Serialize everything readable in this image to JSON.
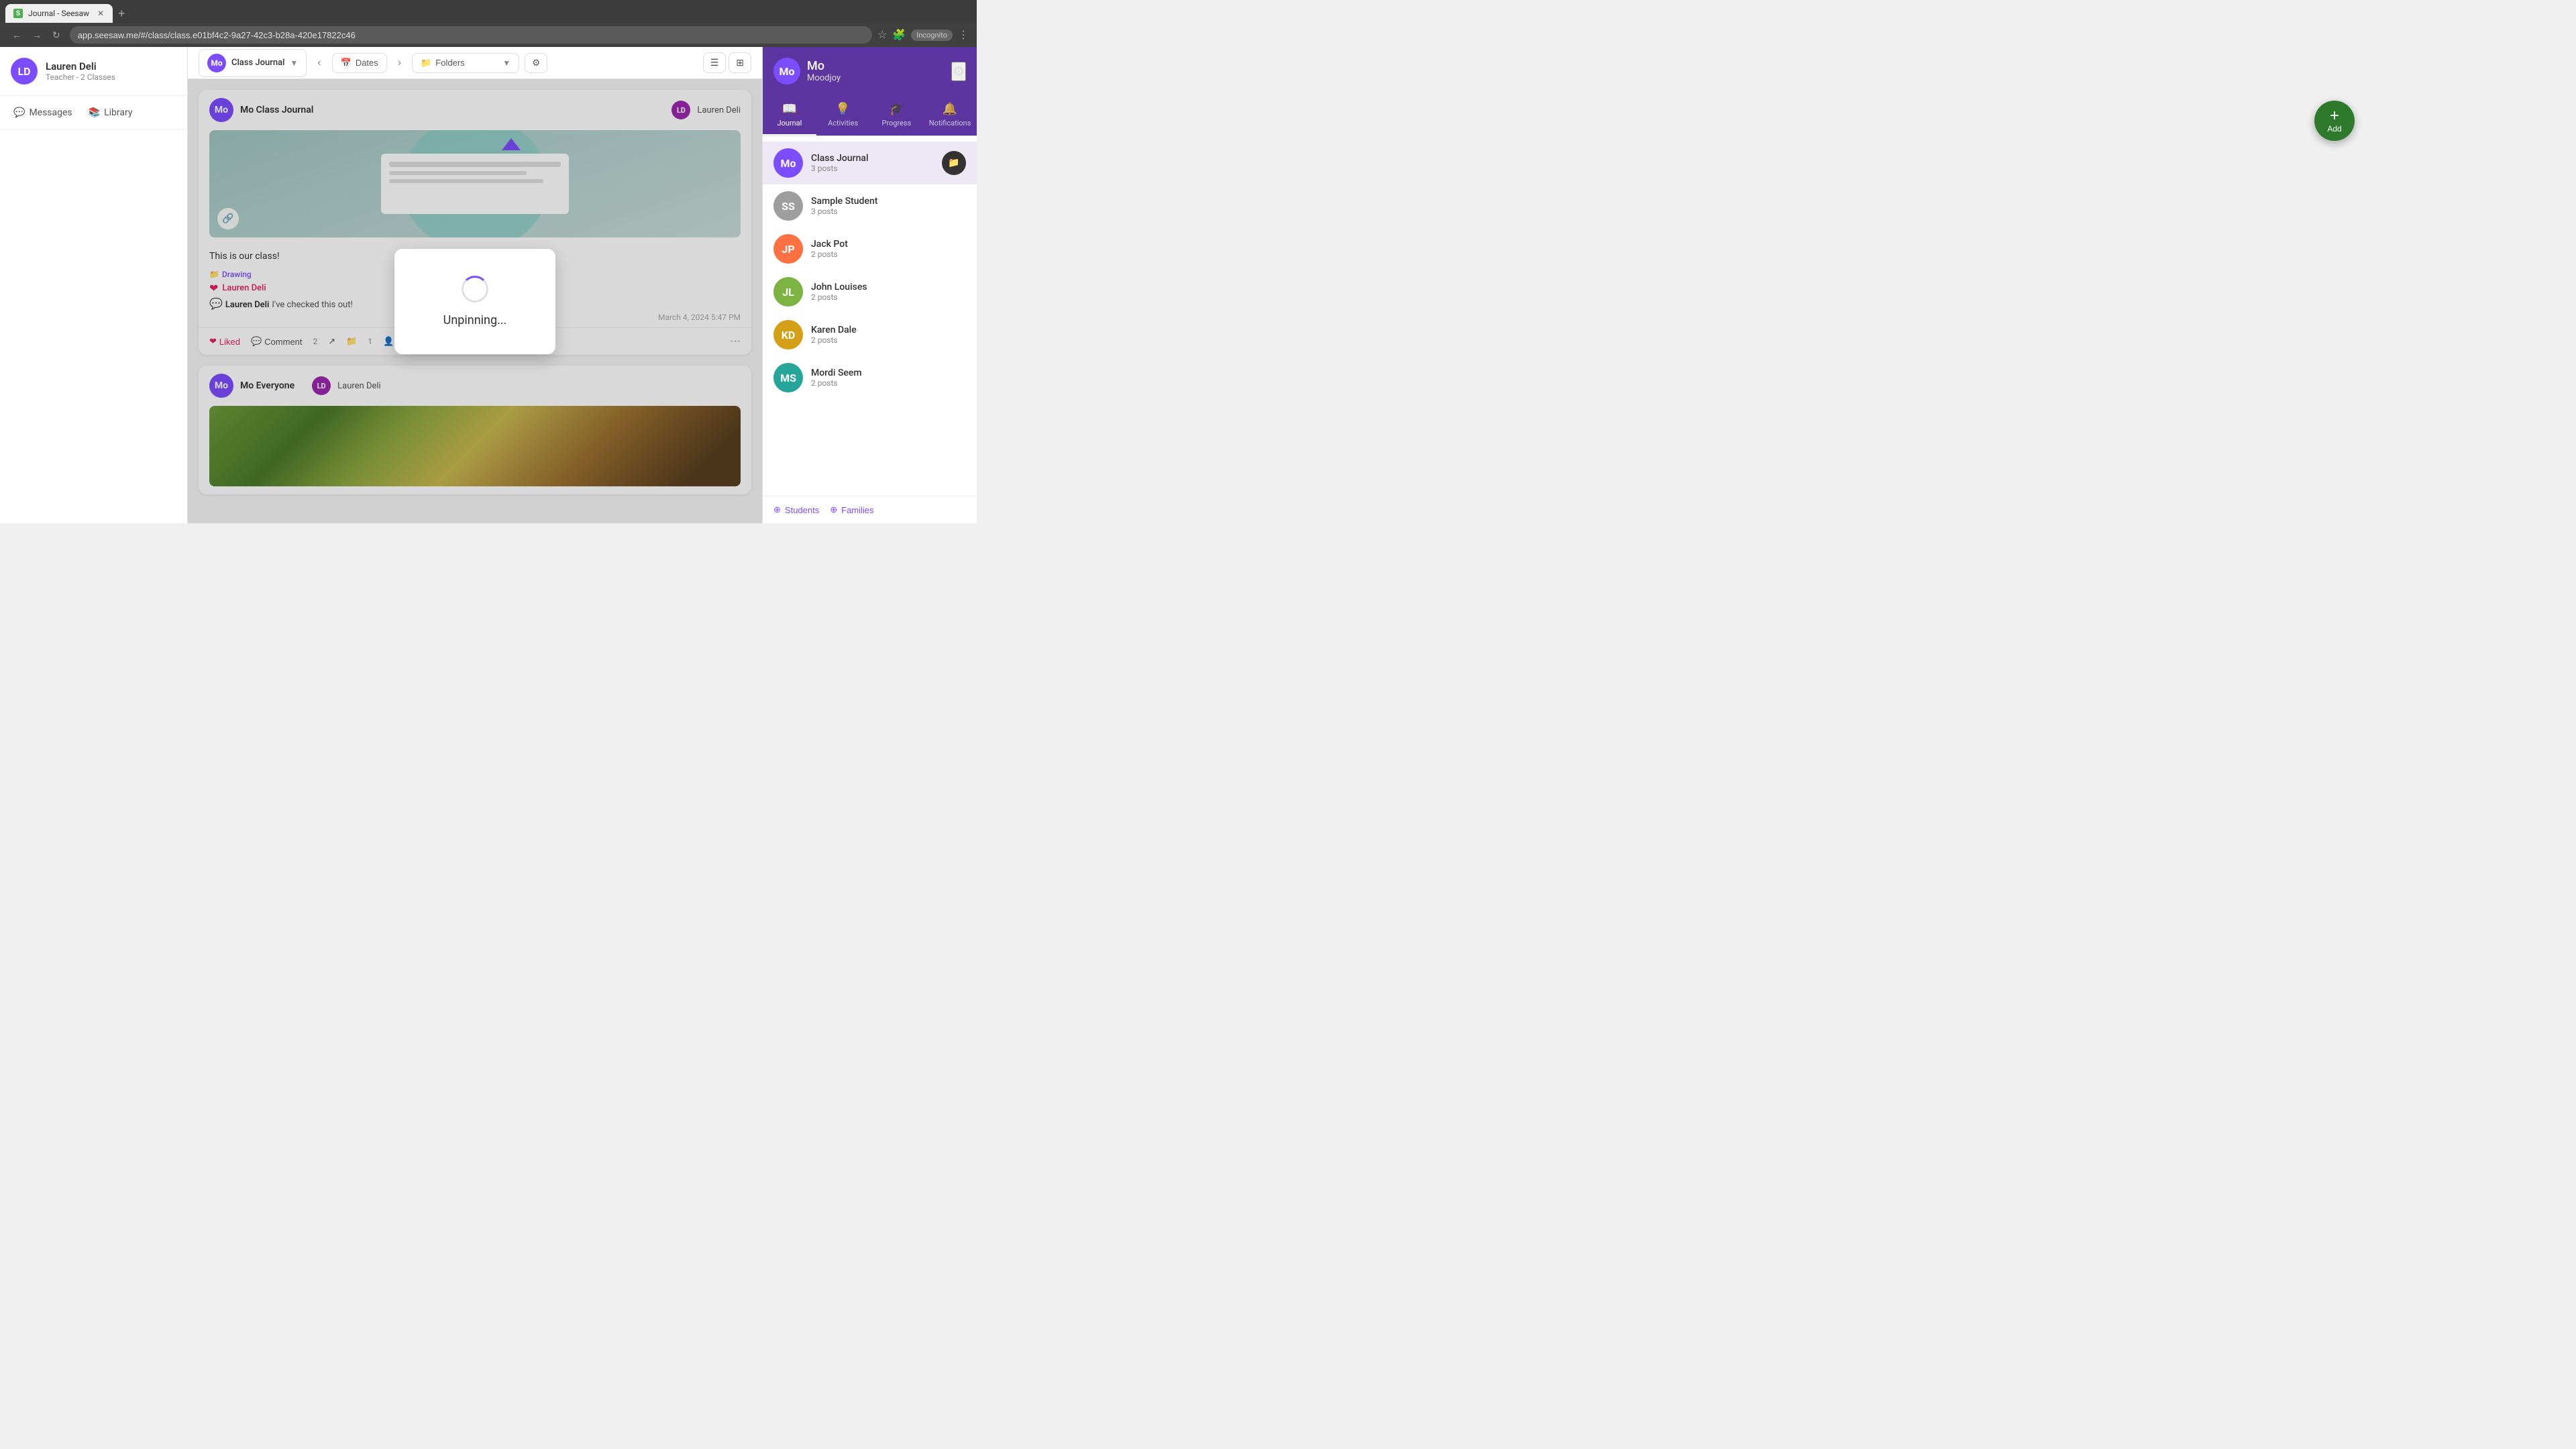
{
  "browser": {
    "tab_title": "Journal - Seesaw",
    "tab_favicon": "S",
    "url": "app.seesaw.me/#/class/class.e01bf4c2-9a27-42c3-b28a-420e17822c46",
    "incognito_label": "Incognito"
  },
  "user": {
    "name": "Lauren Deli",
    "role": "Teacher - 2 Classes",
    "avatar_initials": "LD"
  },
  "nav": {
    "messages_label": "Messages",
    "library_label": "Library"
  },
  "toolbar": {
    "journal_label": "Class Journal",
    "dates_label": "Dates",
    "folders_label": "Folders",
    "avatar_initials": "Mo"
  },
  "add_button": {
    "plus_label": "+",
    "label": "Add"
  },
  "post1": {
    "author": "Mo Class Journal",
    "author_initials": "Mo",
    "avatar_bg": "#7c4dff",
    "teacher_name": "Lauren Deli",
    "teacher_initials": "LD",
    "text": "This is our class!",
    "folder": "Drawing",
    "liked_label": "Lauren Deli",
    "comment_author": "Lauren Deli",
    "comment_text": "I've checked this out!",
    "timestamp": "March 4, 2024 5:47 PM",
    "action_liked": "Liked",
    "action_comment": "Comment",
    "action_comments_count": "2",
    "action_folders_count": "1"
  },
  "post2": {
    "author": "Mo Everyone",
    "author_initials": "Mo",
    "avatar_bg": "#7c4dff",
    "teacher_name": "Lauren Deli",
    "teacher_initials": "LD"
  },
  "unpinning": {
    "text": "Unpinning..."
  },
  "right_sidebar": {
    "user_name": "Mo",
    "username": "Moodjoy",
    "settings_icon": "⚙",
    "tabs": [
      {
        "id": "journal",
        "label": "Journal",
        "icon": "📖",
        "active": true
      },
      {
        "id": "activities",
        "label": "Activities",
        "icon": "💡",
        "active": false
      },
      {
        "id": "progress",
        "label": "Progress",
        "icon": "🎓",
        "active": false
      },
      {
        "id": "notifications",
        "label": "Notifications",
        "icon": "🔔",
        "active": false
      }
    ],
    "students": [
      {
        "name": "Class Journal",
        "initials": "Mo",
        "posts": "3 posts",
        "bg": "#7c4dff",
        "active": true,
        "has_folder": true
      },
      {
        "name": "Sample Student",
        "initials": "SS",
        "posts": "3 posts",
        "bg": "#9e9e9e",
        "active": false,
        "has_folder": false
      },
      {
        "name": "Jack Pot",
        "initials": "JP",
        "posts": "2 posts",
        "bg": "#ff7043",
        "active": false,
        "has_folder": false
      },
      {
        "name": "John Louises",
        "initials": "JL",
        "posts": "2 posts",
        "bg": "#7cb342",
        "active": false,
        "has_folder": false
      },
      {
        "name": "Karen Dale",
        "initials": "KD",
        "posts": "2 posts",
        "bg": "#d4a017",
        "active": false,
        "has_folder": false
      },
      {
        "name": "Mordi Seem",
        "initials": "MS",
        "posts": "2 posts",
        "bg": "#26a69a",
        "active": false,
        "has_folder": false
      }
    ],
    "add_students_label": "Students",
    "add_families_label": "Families"
  }
}
